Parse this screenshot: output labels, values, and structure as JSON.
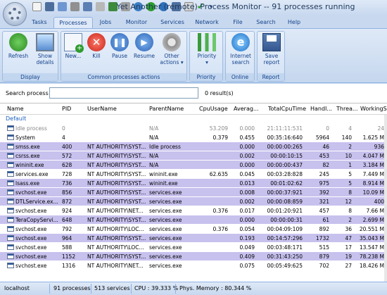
{
  "window": {
    "title": "Yet Another (remote) Process Monitor -- 91 processes running"
  },
  "tabs": [
    {
      "label": "Tasks"
    },
    {
      "label": "Processes"
    },
    {
      "label": "Jobs"
    },
    {
      "label": "Monitor"
    },
    {
      "label": "Services"
    },
    {
      "label": "Network"
    },
    {
      "label": "File"
    },
    {
      "label": "Search"
    },
    {
      "label": "Help"
    }
  ],
  "active_tab": "Processes",
  "ribbon": {
    "display": {
      "label": "Display",
      "refresh": "Refresh",
      "show_details_1": "Show",
      "show_details_2": "details"
    },
    "common": {
      "label": "Common processes actions",
      "new": "New...",
      "kill": "Kill",
      "pause": "Pause",
      "resume": "Resume",
      "other_1": "Other",
      "other_2": "actions"
    },
    "priority": {
      "label": "Priority",
      "button": "Priority"
    },
    "online": {
      "label": "Online",
      "btn_1": "Internet",
      "btn_2": "search"
    },
    "report": {
      "label": "Report",
      "btn_1": "Save",
      "btn_2": "report"
    }
  },
  "search": {
    "label": "Search process",
    "value": "",
    "result": "0 result(s)"
  },
  "columns": [
    "Name",
    "PID",
    "UserName",
    "ParentName",
    "CpuUsage",
    "Averag...",
    "TotalCpuTime",
    "Handl...",
    "Threa...",
    "WorkingS"
  ],
  "group_label": "Default",
  "rows": [
    {
      "name": "Idle process",
      "pid": "0",
      "user": "",
      "parent": "N/A",
      "cpu": "53.209",
      "avg": "0.000",
      "total": "21:11:11:531",
      "handles": "0",
      "threads": "4",
      "ws": "24",
      "style": "gray"
    },
    {
      "name": "System",
      "pid": "4",
      "user": "",
      "parent": "N/A",
      "cpu": "0.379",
      "avg": "0.455",
      "total": "00:35:16:640",
      "handles": "5964",
      "threads": "140",
      "ws": "1.625 M",
      "style": "white"
    },
    {
      "name": "smss.exe",
      "pid": "400",
      "user": "NT AUTHORITY\\SYST...",
      "parent": "Idle process",
      "cpu": "",
      "avg": "0.000",
      "total": "00:00:00:265",
      "handles": "46",
      "threads": "2",
      "ws": "936",
      "style": "purple"
    },
    {
      "name": "csrss.exe",
      "pid": "572",
      "user": "NT AUTHORITY\\SYST...",
      "parent": "N/A",
      "cpu": "",
      "avg": "0.002",
      "total": "00:00:10:15",
      "handles": "453",
      "threads": "10",
      "ws": "4.047 M",
      "style": "purple"
    },
    {
      "name": "wininit.exe",
      "pid": "628",
      "user": "NT AUTHORITY\\SYST...",
      "parent": "N/A",
      "cpu": "",
      "avg": "0.000",
      "total": "00:00:00:437",
      "handles": "82",
      "threads": "1",
      "ws": "3.184 M",
      "style": "purple"
    },
    {
      "name": "services.exe",
      "pid": "728",
      "user": "NT AUTHORITY\\SYST...",
      "parent": "wininit.exe",
      "cpu": "62.635",
      "avg": "0.045",
      "total": "00:03:28:828",
      "handles": "245",
      "threads": "5",
      "ws": "7.449 M",
      "style": "white"
    },
    {
      "name": "lsass.exe",
      "pid": "736",
      "user": "NT AUTHORITY\\SYST...",
      "parent": "wininit.exe",
      "cpu": "",
      "avg": "0.013",
      "total": "00:01:02:62",
      "handles": "975",
      "threads": "5",
      "ws": "8.914 M",
      "style": "purple"
    },
    {
      "name": "svchost.exe",
      "pid": "856",
      "user": "NT AUTHORITY\\SYST...",
      "parent": "services.exe",
      "cpu": "",
      "avg": "0.008",
      "total": "00:00:37:921",
      "handles": "392",
      "threads": "8",
      "ws": "10.09 M",
      "style": "purple"
    },
    {
      "name": "DTLService.ex...",
      "pid": "872",
      "user": "NT AUTHORITY\\SYST...",
      "parent": "services.exe",
      "cpu": "",
      "avg": "0.002",
      "total": "00:00:08:859",
      "handles": "321",
      "threads": "12",
      "ws": "400",
      "style": "purple"
    },
    {
      "name": "svchost.exe",
      "pid": "924",
      "user": "NT AUTHORITY\\NET...",
      "parent": "services.exe",
      "cpu": "0.376",
      "avg": "0.017",
      "total": "00:01:20:921",
      "handles": "457",
      "threads": "8",
      "ws": "7.66 M",
      "style": "white"
    },
    {
      "name": "TeraCopyServi...",
      "pid": "648",
      "user": "NT AUTHORITY\\SYST...",
      "parent": "services.exe",
      "cpu": "",
      "avg": "0.000",
      "total": "00:00:00:31",
      "handles": "61",
      "threads": "2",
      "ws": "2.699 M",
      "style": "purple"
    },
    {
      "name": "svchost.exe",
      "pid": "792",
      "user": "NT AUTHORITY\\LOC...",
      "parent": "services.exe",
      "cpu": "0.376",
      "avg": "0.054",
      "total": "00:04:09:109",
      "handles": "892",
      "threads": "36",
      "ws": "20.551 M",
      "style": "white"
    },
    {
      "name": "svchost.exe",
      "pid": "964",
      "user": "NT AUTHORITY\\SYST...",
      "parent": "services.exe",
      "cpu": "",
      "avg": "0.193",
      "total": "00:14:57:296",
      "handles": "1732",
      "threads": "47",
      "ws": "35.043 M",
      "style": "purple"
    },
    {
      "name": "svchost.exe",
      "pid": "588",
      "user": "NT AUTHORITY\\LOC...",
      "parent": "services.exe",
      "cpu": "",
      "avg": "0.049",
      "total": "00:03:48:171",
      "handles": "515",
      "threads": "17",
      "ws": "13.547 M",
      "style": "white"
    },
    {
      "name": "svchost.exe",
      "pid": "1152",
      "user": "NT AUTHORITY\\SYST...",
      "parent": "services.exe",
      "cpu": "",
      "avg": "0.409",
      "total": "00:31:43:250",
      "handles": "879",
      "threads": "19",
      "ws": "78.238 M",
      "style": "purple"
    },
    {
      "name": "svchost.exe",
      "pid": "1316",
      "user": "NT AUTHORITY\\NET...",
      "parent": "services.exe",
      "cpu": "",
      "avg": "0.075",
      "total": "00:05:49:625",
      "handles": "702",
      "threads": "27",
      "ws": "18.426 M",
      "style": "white"
    }
  ],
  "statusbar": {
    "host": "localhost",
    "processes": "91 processes",
    "services": "513 services",
    "cpu": "CPU : 39.333 %",
    "memory": "Phys. Memory : 80.344 %"
  },
  "colors": {
    "row_highlight": "#c7c1ee",
    "accent": "#15428b",
    "group": "#1b5fbd"
  }
}
